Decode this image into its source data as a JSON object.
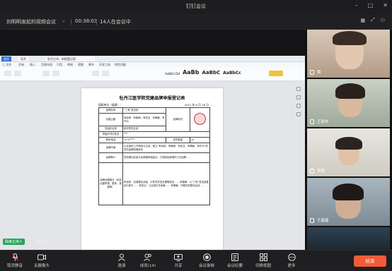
{
  "window": {
    "title": "钉钉会议"
  },
  "infobar": {
    "meeting_title": "刘明明发起的视频会议",
    "elapsed": "00:38:03",
    "members": "14人在会议中"
  },
  "document": {
    "tabs": [
      "首页",
      "稻壳",
      "牡丹江市...申报登记表"
    ],
    "menu": [
      "三 文件",
      "开始",
      "插入",
      "页面布局",
      "引用",
      "审阅",
      "视图",
      "章节",
      "开发工具",
      "特色功能"
    ],
    "styles": [
      "AaBbCcDd",
      "AaBb",
      "AaBbC",
      "AaBbCc"
    ],
    "page_title": "牡丹江医学院党建品牌申报登记表",
    "subrow_left": "填报单位（盖章）：",
    "subrow_right": "2021 年 6 月 28 日",
    "rows": [
      [
        "品牌名称",
        "“三有”党支部",
        "品牌标识",
        ""
      ],
      [
        "创建主题",
        "有信仰、有格局、有担当、有奉献、有作为",
        "",
        ""
      ],
      [
        "党组织名称",
        "医学院党支部",
        "",
        ""
      ],
      [
        "党组织书记姓名",
        "***",
        "",
        ""
      ],
      [
        "联系电话",
        "1376****",
        "党员数量",
        "18"
      ],
      [
        "品牌内涵",
        "以支部的工作特色为主线，建立“有信仰、有格局、有担当、有奉献、有作为”的党员品牌创建体系",
        "",
        ""
      ],
      [
        "品牌释义",
        "坚持理论武装与实践锻炼相结合，打造特色鲜明的工作品牌……",
        "",
        ""
      ],
      [
        "品牌创建做法（包括创建举措、载体、措施等）",
        "有信仰：加强理论武装，引导党员坚定理想信念……  有格局：以“三有”党支部建设为抓手……  有担当：立足岗位作贡献……  有奉献：开展志愿服务活动……",
        "",
        ""
      ]
    ]
  },
  "participants": [
    {
      "name": "我",
      "bg": "#c9b8a8"
    },
    {
      "name": "王丽东",
      "bg": "#b7c4b0"
    },
    {
      "name": "李阳",
      "bg": "#d8d4cc"
    },
    {
      "name": "于鑫鑫",
      "bg": "#9aa7b3"
    },
    {
      "name": "",
      "bg": "#33414c"
    }
  ],
  "host": {
    "badge": "联席主持人",
    "name": "刘明明"
  },
  "toolbar": {
    "items": [
      {
        "label": "取消静音",
        "icon": "mic-muted-icon"
      },
      {
        "label": "关摄像头",
        "icon": "camera-icon"
      },
      {
        "label": "邀请",
        "icon": "invite-icon"
      },
      {
        "label": "成员(14)",
        "icon": "members-icon"
      },
      {
        "label": "共享",
        "icon": "share-icon"
      },
      {
        "label": "会议录制",
        "icon": "record-icon"
      },
      {
        "label": "会议纪要",
        "icon": "minutes-icon"
      },
      {
        "label": "切换视图",
        "icon": "layout-icon"
      },
      {
        "label": "更多",
        "icon": "more-icon"
      }
    ],
    "end_label": "结束"
  },
  "colors": {
    "accent": "#f25b3a",
    "host_badge": "#27a35a"
  }
}
